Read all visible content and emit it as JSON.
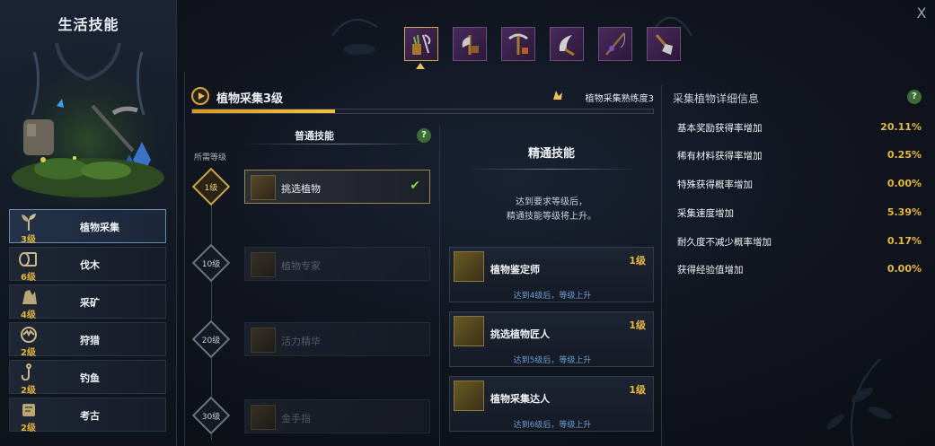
{
  "sidebar": {
    "title": "生活技能",
    "items": [
      {
        "level": "3级",
        "label": "植物采集",
        "icon": "sprout-icon"
      },
      {
        "level": "6级",
        "label": "伐木",
        "icon": "log-icon"
      },
      {
        "level": "4级",
        "label": "采矿",
        "icon": "ore-icon"
      },
      {
        "level": "2级",
        "label": "狩猎",
        "icon": "trap-icon"
      },
      {
        "level": "2级",
        "label": "钓鱼",
        "icon": "hook-icon"
      },
      {
        "level": "2级",
        "label": "考古",
        "icon": "scroll-icon"
      }
    ]
  },
  "toolbar": {
    "icons": [
      "herb-sickle-icon",
      "axe-icon",
      "pickaxe-icon",
      "hunting-blade-icon",
      "fishing-rod-icon",
      "shovel-icon"
    ]
  },
  "header": {
    "title": "植物采集3级",
    "proficiency": "植物采集熟练度3",
    "progress_fraction": 0.31
  },
  "normal": {
    "tab_label": "普通技能",
    "help": "?",
    "req_label": "所需等级",
    "skills": [
      {
        "level": "1级",
        "name": "挑选植物",
        "unlocked": true
      },
      {
        "level": "10级",
        "name": "植物专家",
        "unlocked": false
      },
      {
        "level": "20级",
        "name": "活力精华",
        "unlocked": false
      },
      {
        "level": "30级",
        "name": "金手指",
        "unlocked": false
      }
    ]
  },
  "master": {
    "title": "精通技能",
    "desc_line1": "达到要求等级后，",
    "desc_line2": "精通技能等级将上升。",
    "skills": [
      {
        "name": "植物鉴定师",
        "level": "1级",
        "req": "达到4级后，等级上升"
      },
      {
        "name": "挑选植物匠人",
        "level": "1级",
        "req": "达到5级后，等级上升"
      },
      {
        "name": "植物采集达人",
        "level": "1级",
        "req": "达到6级后，等级上升"
      }
    ]
  },
  "detail": {
    "title": "采集植物详细信息",
    "help": "?",
    "rows": [
      {
        "label": "基本奖励获得率增加",
        "value": "20.11%"
      },
      {
        "label": "稀有材料获得率增加",
        "value": "0.25%"
      },
      {
        "label": "特殊获得概率增加",
        "value": "0.00%"
      },
      {
        "label": "采集速度增加",
        "value": "5.39%"
      },
      {
        "label": "耐久度不减少概率增加",
        "value": "0.17%"
      },
      {
        "label": "获得经验值增加",
        "value": "0.00%"
      }
    ]
  },
  "close_label": "X",
  "colors": {
    "accent": "#e8b93e",
    "link": "#6f9ed8",
    "check": "#8ed04a"
  }
}
